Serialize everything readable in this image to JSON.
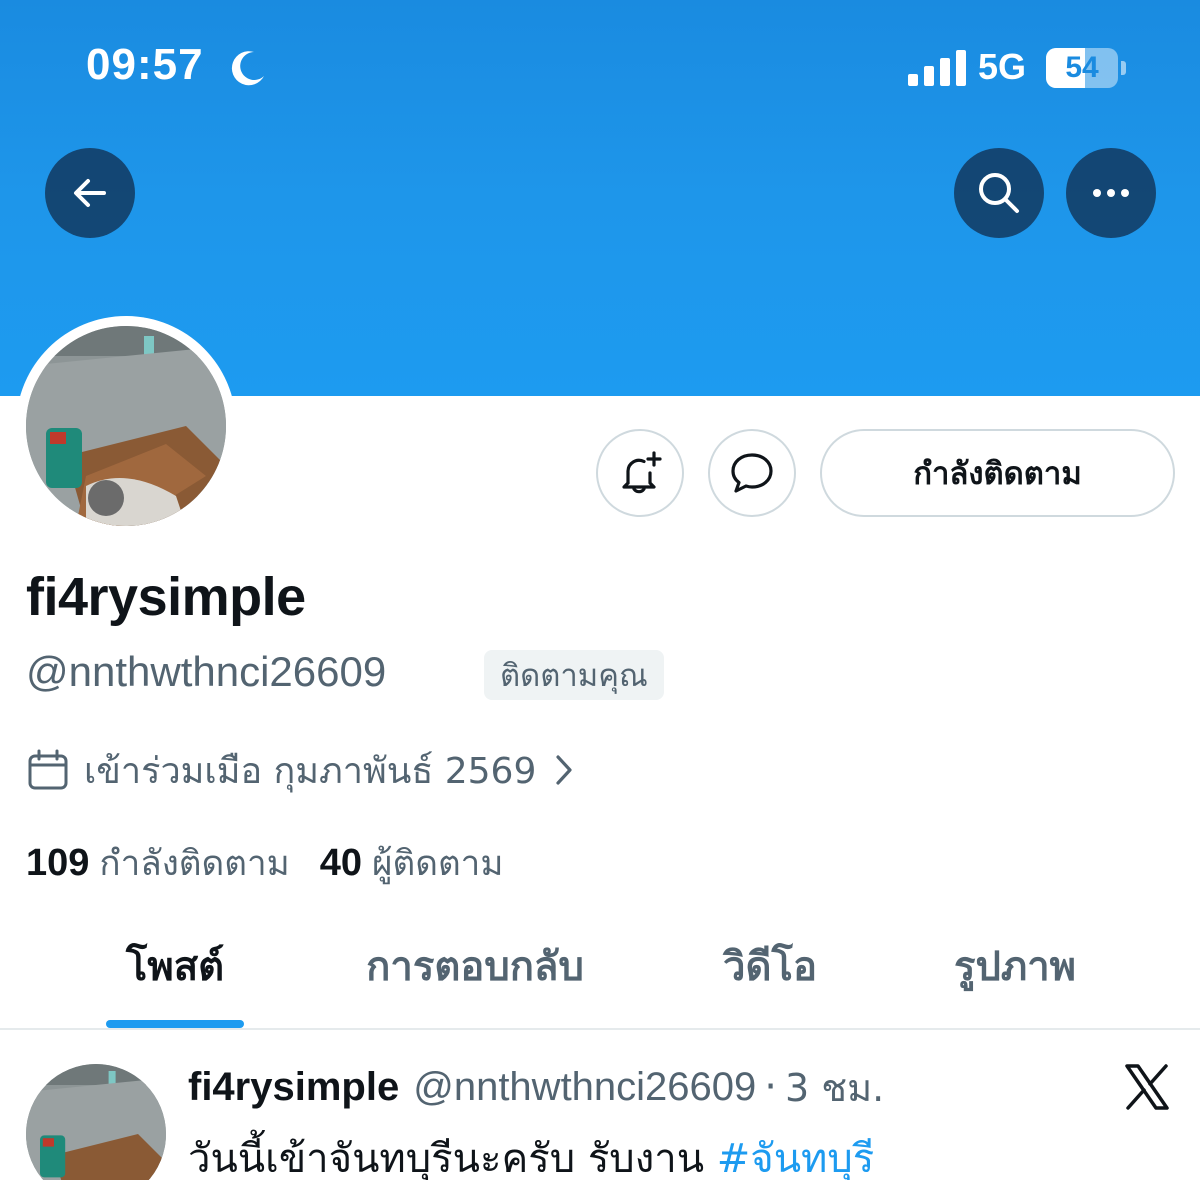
{
  "status_bar": {
    "time": "09:57",
    "network": "5G",
    "battery": "54",
    "battery_level": 0.54
  },
  "header": {
    "back_icon": "arrow-left-icon",
    "search_icon": "search-icon",
    "more_icon": "more-horizontal-icon",
    "banner_color": "#1d9bf0"
  },
  "profile": {
    "display_name": "fi4rysimple",
    "handle": "@nnthwthnci26609",
    "follows_you_badge": "ติดตามคุณ",
    "joined": "เข้าร่วมเมือ กุมภาพันธ์ 2569",
    "following_count": "109",
    "following_label": "กำลังติดตาม",
    "followers_count": "40",
    "followers_label": "ผู้ติดตาม"
  },
  "actions": {
    "following_button": "กำลังติดตาม",
    "notify_icon": "bell-plus-icon",
    "message_icon": "chat-bubble-icon"
  },
  "tabs": [
    {
      "label": "โพสต์",
      "active": true
    },
    {
      "label": "การตอบกลับ",
      "active": false
    },
    {
      "label": "วิดีโอ",
      "active": false
    },
    {
      "label": "รูปภาพ",
      "active": false
    }
  ],
  "post": {
    "name": "fi4rysimple",
    "handle": "@nnthwthnci26609",
    "separator": "·",
    "time": "3 ชม.",
    "text": "วันนี้เข้าจันทบุรีนะครับ รับงาน ",
    "hashtag": "#จันทบุรี",
    "brand_icon": "x-logo-icon"
  },
  "colors": {
    "accent": "#1d9bf0",
    "secondary_text": "#536471",
    "primary_text": "#0f1419"
  }
}
